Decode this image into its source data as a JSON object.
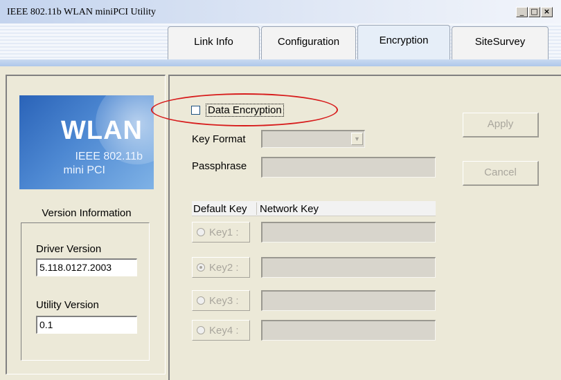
{
  "window": {
    "title": "IEEE 802.11b WLAN miniPCI Utility",
    "minimize_glyph": "_",
    "maximize_glyph": "□",
    "close_glyph": "×"
  },
  "tabs": [
    {
      "label": "Link Info",
      "active": false
    },
    {
      "label": "Configuration",
      "active": false
    },
    {
      "label": "Encryption",
      "active": true
    },
    {
      "label": "SiteSurvey",
      "active": false
    }
  ],
  "logo": {
    "main": "WLAN",
    "line1": "IEEE 802.11b",
    "line2": "mini PCI"
  },
  "version": {
    "section_label": "Version Information",
    "driver_label": "Driver Version",
    "driver_value": "5.118.0127.2003",
    "utility_label": "Utility Version",
    "utility_value": "0.1"
  },
  "encryption": {
    "data_encryption_label": "Data Encryption",
    "data_encryption_checked": false,
    "key_format_label": "Key Format",
    "key_format_value": "",
    "passphrase_label": "Passphrase",
    "passphrase_value": "",
    "apply_label": "Apply",
    "cancel_label": "Cancel",
    "table_headers": {
      "default_key": "Default Key",
      "network_key": "Network Key"
    },
    "keys": [
      {
        "label": "Key1 :",
        "selected": false,
        "value": ""
      },
      {
        "label": "Key2 :",
        "selected": true,
        "value": ""
      },
      {
        "label": "Key3 :",
        "selected": false,
        "value": ""
      },
      {
        "label": "Key4 :",
        "selected": false,
        "value": ""
      }
    ]
  },
  "colors": {
    "highlight_oval": "#d71c1c",
    "disabled_text": "#a9a69d",
    "dialog_bg": "#ece9d8"
  }
}
